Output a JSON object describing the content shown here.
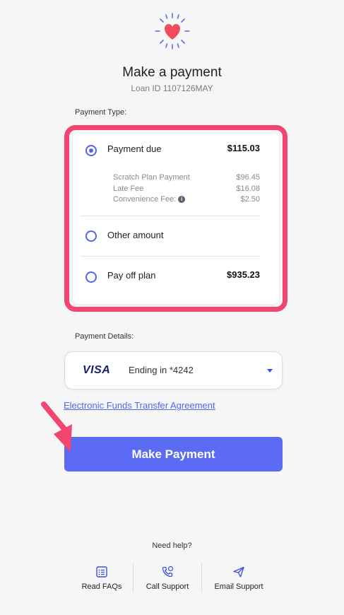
{
  "header": {
    "title": "Make a payment",
    "loan_id": "Loan ID 1107126MAY"
  },
  "payment_type": {
    "label": "Payment Type:",
    "options": [
      {
        "label": "Payment due",
        "amount": "$115.03",
        "selected": true
      },
      {
        "label": "Other amount",
        "amount": "",
        "selected": false
      },
      {
        "label": "Pay off plan",
        "amount": "$935.23",
        "selected": false
      }
    ],
    "breakdown": [
      {
        "label": "Scratch Plan Payment",
        "amount": "$96.45"
      },
      {
        "label": "Late Fee",
        "amount": "$16.08"
      },
      {
        "label": "Convenience Fee:",
        "amount": "$2.50"
      }
    ]
  },
  "payment_details": {
    "label": "Payment Details:",
    "card_brand": "VISA",
    "card_ending": "Ending in *4242"
  },
  "eft_link": "Electronic Funds Transfer Agreement",
  "cta": "Make Payment",
  "help": {
    "prompt": "Need help?",
    "items": [
      {
        "label": "Read FAQs",
        "icon": "faq-icon"
      },
      {
        "label": "Call Support",
        "icon": "phone-icon"
      },
      {
        "label": "Email Support",
        "icon": "send-icon"
      }
    ]
  },
  "colors": {
    "accent": "#5b6bf4",
    "highlight": "#f2456f",
    "heart": "#f04e5e",
    "background": "#f6f6f6"
  }
}
